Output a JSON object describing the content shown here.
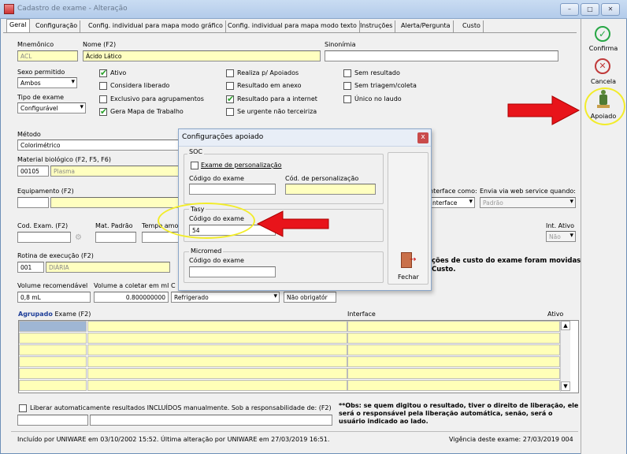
{
  "window": {
    "title": "Cadastro de exame - Alteração",
    "min": "–",
    "max": "□",
    "close": "✕"
  },
  "tabs": [
    "Geral",
    "Configuração",
    "Config. individual para mapa modo gráfico",
    "Config. individual para mapa modo texto",
    "Instruções",
    "Alerta/Pergunta",
    "Custo"
  ],
  "form": {
    "mnemonico_label": "Mnemônico",
    "mnemonico": "ACL",
    "nome_label": "Nome (F2)",
    "nome": "Ácido Lático",
    "sinonimia_label": "Sinonímia",
    "sinonimia": "",
    "sexo_label": "Sexo permitido",
    "sexo": "Ambos",
    "tipo_label": "Tipo de exame",
    "tipo": "Configurável",
    "checks_col1": [
      {
        "label": "Ativo",
        "checked": true
      },
      {
        "label": "Considera liberado",
        "checked": false
      },
      {
        "label": "Exclusivo para agrupamentos",
        "checked": false
      },
      {
        "label": "Gera Mapa de Trabalho",
        "checked": true
      }
    ],
    "checks_col2": [
      {
        "label": "Realiza p/ Apoiados",
        "checked": false
      },
      {
        "label": "Resultado em anexo",
        "checked": false
      },
      {
        "label": "Resultado para a internet",
        "checked": true
      },
      {
        "label": "Se urgente não terceiriza",
        "checked": false
      }
    ],
    "checks_col3": [
      {
        "label": "Sem resultado",
        "checked": false
      },
      {
        "label": "Sem triagem/coleta",
        "checked": false
      },
      {
        "label": "Único no laudo",
        "checked": false
      }
    ],
    "metodo_label": "Método",
    "metodo": "Colorimétrico",
    "material_label": "Material biológico (F2, F5, F6)",
    "material_code": "00105",
    "material": "Plasma",
    "equip_label": "Equipamento (F2)",
    "interface_como_label": "nterface como:",
    "interface_como": "nterface",
    "envia_label": "Envia via web service quando:",
    "envia": "Padrão",
    "codexam_label": "Cod. Exam. (F2)",
    "matpadrao_label": "Mat. Padrão",
    "tempo_label": "Tempo amo",
    "intativo_label": "Int. Ativo",
    "intativo": "Não",
    "rotina_label": "Rotina de execução (F2)",
    "rotina_code": "001",
    "rotina": "DIÁRIA",
    "custo_msg_1": "ções de custo do exame foram movidas",
    "custo_msg_2": "Custo.",
    "vol_rec_label": "Volume recomendável",
    "vol_rec": "0,8 mL",
    "vol_col_label": "Volume a coletar em ml",
    "vol_col": "0.800000000",
    "cons_label": "C",
    "cons": "Refrigerado",
    "obrig": "Não obrigatór"
  },
  "grid": {
    "col_agrupado": "Agrupado",
    "col_exame": "Exame (F2)",
    "col_interface": "Interface",
    "col_ativo": "Ativo"
  },
  "liberar": {
    "label": "Liberar automaticamente resultados INCLUÍDOS manualmente. Sob a responsabilidade de: (F2)",
    "obs": "**Obs: se quem digitou o resultado, tiver o direito de liberação, ele será o responsável pela liberação automática, senão, será o usuário indicado ao lado."
  },
  "status": {
    "left": "Incluído por UNIWARE em 03/10/2002 15:52. Última alteração por UNIWARE em 27/03/2019 16:51.",
    "right": "Vigência deste exame: 27/03/2019 004"
  },
  "sidebar": {
    "confirma": "Confirma",
    "cancela": "Cancela",
    "apoiado": "Apoiado"
  },
  "dialog": {
    "title": "Configurações apoiado",
    "close": "x",
    "soc_label": "SOC",
    "soc_personal": "Exame de personalização",
    "soc_cod_exame_label": "Código do exame",
    "soc_cod_pers_label": "Cód. de personalização",
    "tasy_label": "Tasy",
    "tasy_cod_label": "Código do exame",
    "tasy_cod": "54",
    "micromed_label": "Micromed",
    "micromed_cod_label": "Código do exame",
    "fechar": "Fechar"
  },
  "colors": {
    "highlight": "#ffff00",
    "arrow": "#e8141a",
    "check": "#2aa12a"
  }
}
